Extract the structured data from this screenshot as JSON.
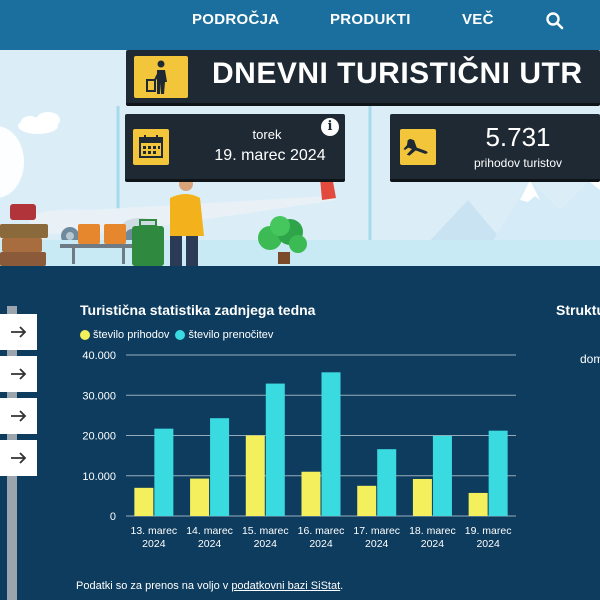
{
  "nav": {
    "items": [
      "PODROČJA",
      "PRODUKTI",
      "VEČ"
    ],
    "search_icon": "search-icon"
  },
  "hero": {
    "title": "DNEVNI TURISTIČNI UTR",
    "date_day": "torek",
    "date_value": "19. marec 2024",
    "arrivals_value": "5.731",
    "arrivals_label": "prihodov turistov",
    "info_glyph": "i",
    "icons": [
      "traveler-icon",
      "calendar-icon",
      "airplane-arrival-icon",
      "info-icon"
    ]
  },
  "side_buttons": [
    "arrow-right-icon",
    "arrow-right-icon",
    "arrow-right-icon",
    "arrow-right-icon"
  ],
  "chart": {
    "title": "Turistična statistika zadnjega tedna"
  },
  "chart_data": {
    "type": "bar",
    "title": "Turistična statistika zadnjega tedna",
    "categories": [
      [
        "13. marec",
        "2024"
      ],
      [
        "14. marec",
        "2024"
      ],
      [
        "15. marec",
        "2024"
      ],
      [
        "16. marec",
        "2024"
      ],
      [
        "17. marec",
        "2024"
      ],
      [
        "18. marec",
        "2024"
      ],
      [
        "19. marec",
        "2024"
      ]
    ],
    "series": [
      {
        "name": "število prihodov",
        "color": "#f4ef5c",
        "values": [
          7000,
          9300,
          20000,
          11000,
          7500,
          9200,
          5731
        ]
      },
      {
        "name": "število prenočitev",
        "color": "#3adbe0",
        "values": [
          21700,
          24300,
          32900,
          35700,
          16600,
          19900,
          21200
        ]
      }
    ],
    "yticks": [
      "0",
      "10.000",
      "20.000",
      "30.000",
      "40.000"
    ],
    "ylim": [
      0,
      40000
    ],
    "grid": true,
    "legend": "top-left"
  },
  "right_panel": {
    "title": "Struktu",
    "label": "dom"
  },
  "footer": {
    "prefix": "Podatki so za prenos na voljo v ",
    "link": "podatkovni bazi SiStat",
    "suffix": "."
  }
}
